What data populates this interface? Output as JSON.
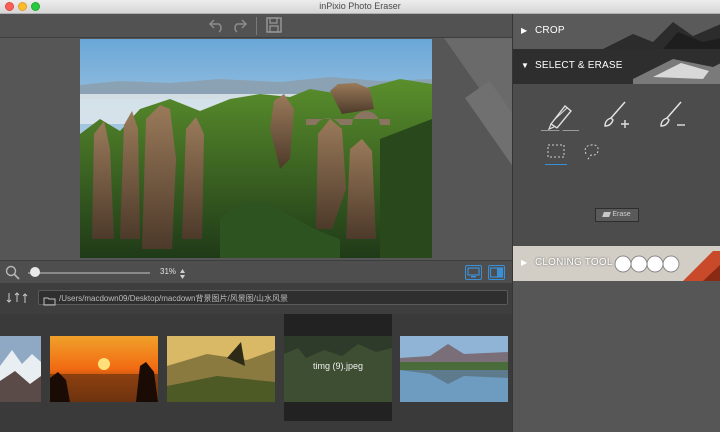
{
  "window": {
    "title": "inPixio Photo Eraser"
  },
  "toolbar": {
    "icons": [
      "undo-icon",
      "redo-icon",
      "save-icon"
    ]
  },
  "zoom": {
    "value": "31%",
    "fraction": 0.31
  },
  "browser": {
    "path": "/Users/macdown09/Desktop/macdown背景图片/风景图/山水风景",
    "thumbnails": [
      {
        "label": ""
      },
      {
        "label": ""
      },
      {
        "label": ""
      },
      {
        "label": "timg (9).jpeg",
        "selected": true
      },
      {
        "label": ""
      }
    ]
  },
  "panel": {
    "crop_label": "CROP",
    "select_erase_label": "SELECT & ERASE",
    "cloning_label": "CLONING TOOL",
    "erase_button": "Erase"
  },
  "colors": {
    "accent": "#3a8fd9",
    "background": "#4c4c4c"
  }
}
